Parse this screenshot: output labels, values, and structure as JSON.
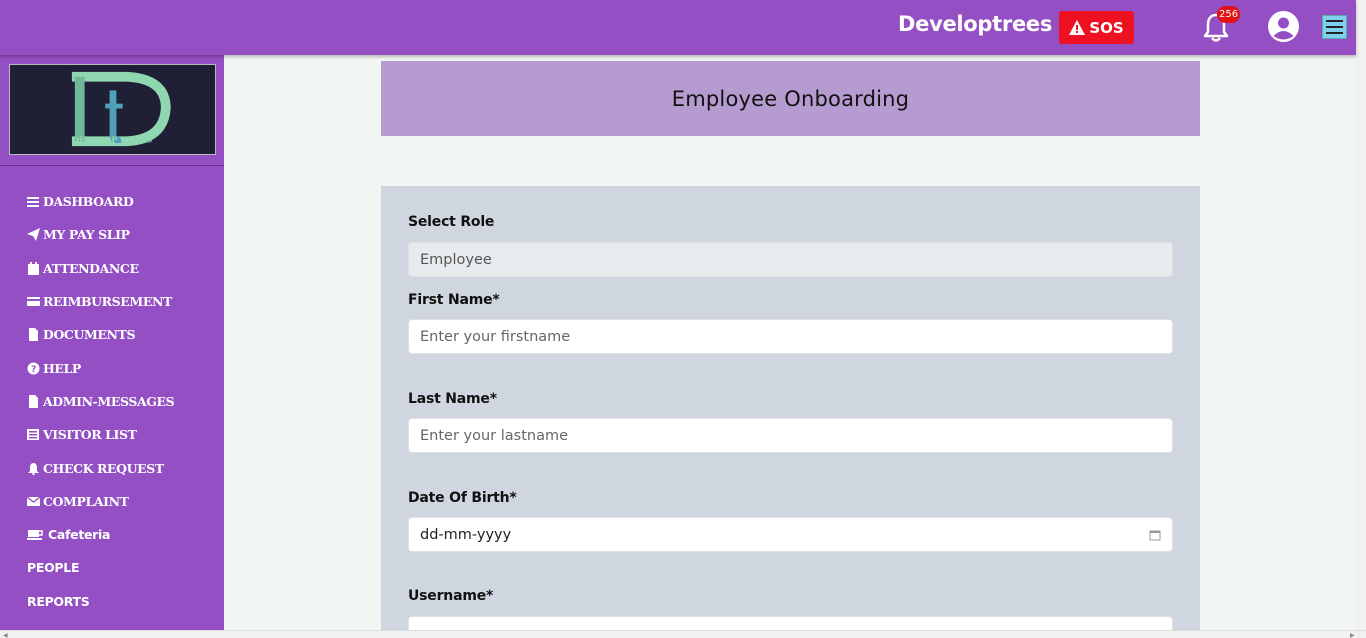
{
  "topbar": {
    "brand": "Developtrees",
    "sos_label": "SOS",
    "notification_count": "256",
    "colors": {
      "bar": "#944fc4",
      "sos": "#ee1122",
      "badge": "#e31111",
      "menu": "#7ed0ec"
    }
  },
  "sidebar": {
    "logo_alt": "DEVELOPTREES",
    "items": [
      {
        "label": "DASHBOARD",
        "icon": "bars-icon"
      },
      {
        "label": "MY PAY SLIP",
        "icon": "paper-plane-icon"
      },
      {
        "label": "ATTENDANCE",
        "icon": "calendar-icon"
      },
      {
        "label": "REIMBURSEMENT",
        "icon": "credit-card-icon"
      },
      {
        "label": "DOCUMENTS",
        "icon": "file-icon"
      },
      {
        "label": "HELP",
        "icon": "question-circle-icon"
      },
      {
        "label": "ADMIN-MESSAGES",
        "icon": "file-icon"
      },
      {
        "label": "VISITOR LIST",
        "icon": "list-icon"
      },
      {
        "label": "CHECK REQUEST",
        "icon": "bell-icon"
      },
      {
        "label": "COMPLAINT",
        "icon": "envelope-icon"
      },
      {
        "label": "Cafeteria",
        "icon": "coffee-icon"
      },
      {
        "label": "PEOPLE",
        "icon": ""
      },
      {
        "label": "REPORTS",
        "icon": ""
      }
    ]
  },
  "main": {
    "title": "Employee Onboarding",
    "form": {
      "role_label": "Select Role",
      "role_value": "Employee",
      "first_name_label": "First Name*",
      "first_name_placeholder": "Enter your firstname",
      "last_name_label": "Last Name*",
      "last_name_placeholder": "Enter your lastname",
      "dob_label": "Date Of Birth*",
      "dob_placeholder": "dd-mm-yyyy",
      "username_label": "Username*"
    }
  }
}
